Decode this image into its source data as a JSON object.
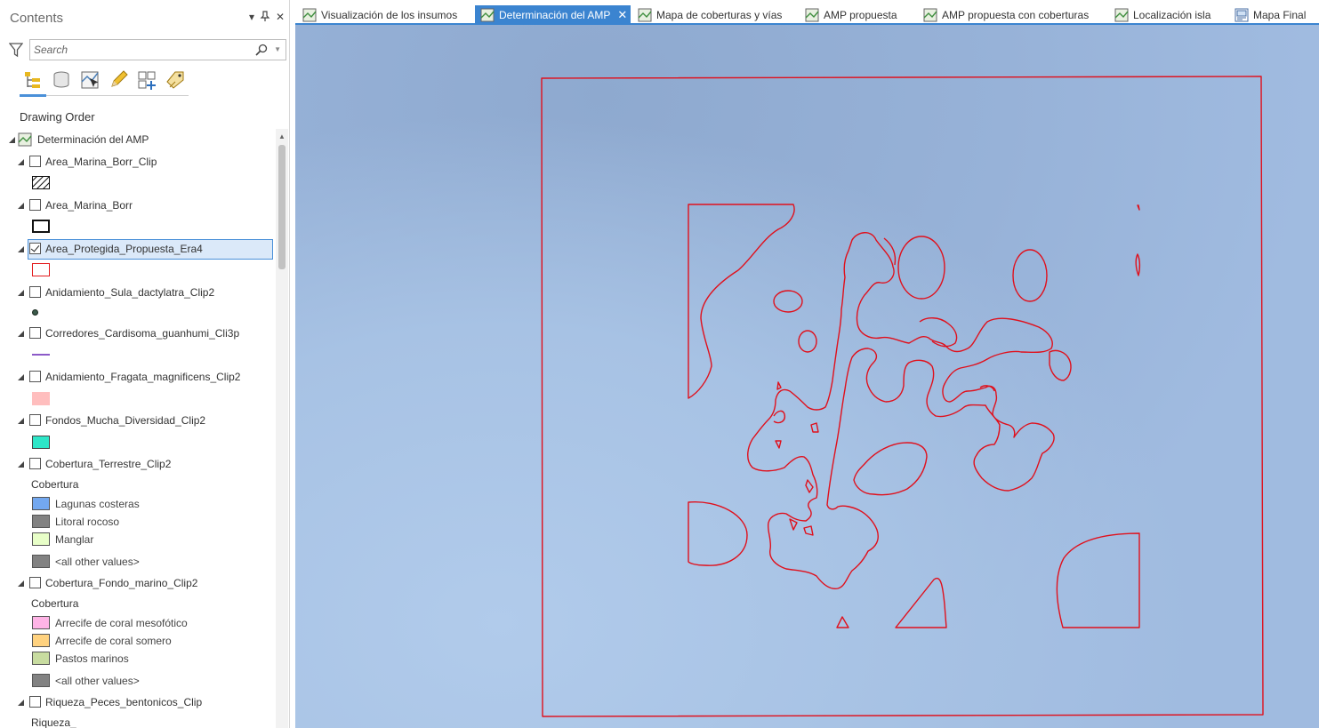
{
  "contents": {
    "title": "Contents",
    "pin_symbol": "⊥",
    "close_symbol": "✕",
    "menu_symbol": "▾",
    "search": {
      "placeholder": "Search"
    },
    "toolbar_icons": [
      "list-by-drawing-order-icon",
      "list-by-source-icon",
      "list-by-selection-icon",
      "list-by-editing-icon",
      "list-by-snapping-icon",
      "list-by-labeling-icon"
    ],
    "drawing_order_heading": "Drawing Order",
    "map_name": "Determinación del AMP",
    "layers": [
      {
        "name": "Area_Marina_Borr_Clip",
        "checked": false
      },
      {
        "name": "Area_Marina_Borr",
        "checked": false
      },
      {
        "name": "Area_Protegida_Propuesta_Era4",
        "checked": true
      },
      {
        "name": "Anidamiento_Sula_dactylatra_Clip2",
        "checked": false
      },
      {
        "name": "Corredores_Cardisoma_guanhumi_Cli3p",
        "checked": false
      },
      {
        "name": "Anidamiento_Fragata_magnificens_Clip2",
        "checked": false
      },
      {
        "name": "Fondos_Mucha_Diversidad_Clip2",
        "checked": false
      },
      {
        "name": "Cobertura_Terrestre_Clip2",
        "checked": false
      },
      {
        "name": "Cobertura_Fondo_marino_Clip2",
        "checked": false
      },
      {
        "name": "Riqueza_Peces_bentonicos_Clip",
        "checked": false
      }
    ],
    "legend_terrestre": {
      "heading": "Cobertura",
      "classes": [
        {
          "label": "Lagunas costeras",
          "color": "#73a8f0"
        },
        {
          "label": "Litoral rocoso",
          "color": "#828282"
        },
        {
          "label": "Manglar",
          "color": "#e8ffc8"
        },
        {
          "label": "<all other values>",
          "color": "#828282"
        }
      ]
    },
    "legend_fondo": {
      "heading": "Cobertura",
      "classes": [
        {
          "label": "Arrecife de coral mesofótico",
          "color": "#ffb4e6"
        },
        {
          "label": "Arrecife de coral somero",
          "color": "#ffd27f"
        },
        {
          "label": "Pastos marinos",
          "color": "#c8dca0"
        },
        {
          "label": "<all other values>",
          "color": "#828282"
        }
      ]
    },
    "riqueza_heading": "Riqueza_",
    "symbol_colors": {
      "fragata_fill": "#ffbebe",
      "diversidad_fill": "#2ee6c8",
      "protegida_stroke": "#e31a1c",
      "corredores_line": "#8c5ac8",
      "sula_point": "#3a5a4a"
    }
  },
  "tabs": [
    {
      "label": "Visualización de los insumos",
      "active": false
    },
    {
      "label": "Determinación del AMP",
      "active": true
    },
    {
      "label": "Mapa de coberturas y vías",
      "active": false
    },
    {
      "label": "AMP propuesta",
      "active": false
    },
    {
      "label": "AMP propuesta con coberturas",
      "active": false
    },
    {
      "label": "Localización isla",
      "active": false
    },
    {
      "label": "Mapa Final",
      "active": false
    }
  ],
  "map": {
    "outline_color": "#e0101c",
    "background_color": "#a0bbe0"
  }
}
